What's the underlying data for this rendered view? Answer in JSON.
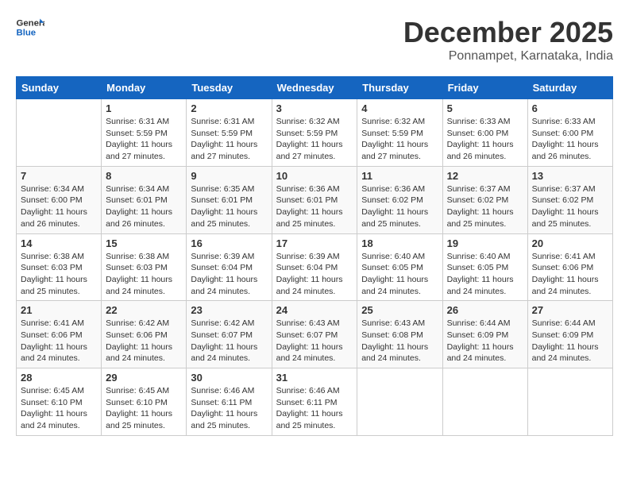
{
  "header": {
    "logo_line1": "General",
    "logo_line2": "Blue",
    "month": "December 2025",
    "location": "Ponnampet, Karnataka, India"
  },
  "weekdays": [
    "Sunday",
    "Monday",
    "Tuesday",
    "Wednesday",
    "Thursday",
    "Friday",
    "Saturday"
  ],
  "weeks": [
    [
      {
        "day": "",
        "info": ""
      },
      {
        "day": "1",
        "info": "Sunrise: 6:31 AM\nSunset: 5:59 PM\nDaylight: 11 hours\nand 27 minutes."
      },
      {
        "day": "2",
        "info": "Sunrise: 6:31 AM\nSunset: 5:59 PM\nDaylight: 11 hours\nand 27 minutes."
      },
      {
        "day": "3",
        "info": "Sunrise: 6:32 AM\nSunset: 5:59 PM\nDaylight: 11 hours\nand 27 minutes."
      },
      {
        "day": "4",
        "info": "Sunrise: 6:32 AM\nSunset: 5:59 PM\nDaylight: 11 hours\nand 27 minutes."
      },
      {
        "day": "5",
        "info": "Sunrise: 6:33 AM\nSunset: 6:00 PM\nDaylight: 11 hours\nand 26 minutes."
      },
      {
        "day": "6",
        "info": "Sunrise: 6:33 AM\nSunset: 6:00 PM\nDaylight: 11 hours\nand 26 minutes."
      }
    ],
    [
      {
        "day": "7",
        "info": "Sunrise: 6:34 AM\nSunset: 6:00 PM\nDaylight: 11 hours\nand 26 minutes."
      },
      {
        "day": "8",
        "info": "Sunrise: 6:34 AM\nSunset: 6:01 PM\nDaylight: 11 hours\nand 26 minutes."
      },
      {
        "day": "9",
        "info": "Sunrise: 6:35 AM\nSunset: 6:01 PM\nDaylight: 11 hours\nand 25 minutes."
      },
      {
        "day": "10",
        "info": "Sunrise: 6:36 AM\nSunset: 6:01 PM\nDaylight: 11 hours\nand 25 minutes."
      },
      {
        "day": "11",
        "info": "Sunrise: 6:36 AM\nSunset: 6:02 PM\nDaylight: 11 hours\nand 25 minutes."
      },
      {
        "day": "12",
        "info": "Sunrise: 6:37 AM\nSunset: 6:02 PM\nDaylight: 11 hours\nand 25 minutes."
      },
      {
        "day": "13",
        "info": "Sunrise: 6:37 AM\nSunset: 6:02 PM\nDaylight: 11 hours\nand 25 minutes."
      }
    ],
    [
      {
        "day": "14",
        "info": "Sunrise: 6:38 AM\nSunset: 6:03 PM\nDaylight: 11 hours\nand 25 minutes."
      },
      {
        "day": "15",
        "info": "Sunrise: 6:38 AM\nSunset: 6:03 PM\nDaylight: 11 hours\nand 24 minutes."
      },
      {
        "day": "16",
        "info": "Sunrise: 6:39 AM\nSunset: 6:04 PM\nDaylight: 11 hours\nand 24 minutes."
      },
      {
        "day": "17",
        "info": "Sunrise: 6:39 AM\nSunset: 6:04 PM\nDaylight: 11 hours\nand 24 minutes."
      },
      {
        "day": "18",
        "info": "Sunrise: 6:40 AM\nSunset: 6:05 PM\nDaylight: 11 hours\nand 24 minutes."
      },
      {
        "day": "19",
        "info": "Sunrise: 6:40 AM\nSunset: 6:05 PM\nDaylight: 11 hours\nand 24 minutes."
      },
      {
        "day": "20",
        "info": "Sunrise: 6:41 AM\nSunset: 6:06 PM\nDaylight: 11 hours\nand 24 minutes."
      }
    ],
    [
      {
        "day": "21",
        "info": "Sunrise: 6:41 AM\nSunset: 6:06 PM\nDaylight: 11 hours\nand 24 minutes."
      },
      {
        "day": "22",
        "info": "Sunrise: 6:42 AM\nSunset: 6:06 PM\nDaylight: 11 hours\nand 24 minutes."
      },
      {
        "day": "23",
        "info": "Sunrise: 6:42 AM\nSunset: 6:07 PM\nDaylight: 11 hours\nand 24 minutes."
      },
      {
        "day": "24",
        "info": "Sunrise: 6:43 AM\nSunset: 6:07 PM\nDaylight: 11 hours\nand 24 minutes."
      },
      {
        "day": "25",
        "info": "Sunrise: 6:43 AM\nSunset: 6:08 PM\nDaylight: 11 hours\nand 24 minutes."
      },
      {
        "day": "26",
        "info": "Sunrise: 6:44 AM\nSunset: 6:09 PM\nDaylight: 11 hours\nand 24 minutes."
      },
      {
        "day": "27",
        "info": "Sunrise: 6:44 AM\nSunset: 6:09 PM\nDaylight: 11 hours\nand 24 minutes."
      }
    ],
    [
      {
        "day": "28",
        "info": "Sunrise: 6:45 AM\nSunset: 6:10 PM\nDaylight: 11 hours\nand 24 minutes."
      },
      {
        "day": "29",
        "info": "Sunrise: 6:45 AM\nSunset: 6:10 PM\nDaylight: 11 hours\nand 25 minutes."
      },
      {
        "day": "30",
        "info": "Sunrise: 6:46 AM\nSunset: 6:11 PM\nDaylight: 11 hours\nand 25 minutes."
      },
      {
        "day": "31",
        "info": "Sunrise: 6:46 AM\nSunset: 6:11 PM\nDaylight: 11 hours\nand 25 minutes."
      },
      {
        "day": "",
        "info": ""
      },
      {
        "day": "",
        "info": ""
      },
      {
        "day": "",
        "info": ""
      }
    ]
  ]
}
